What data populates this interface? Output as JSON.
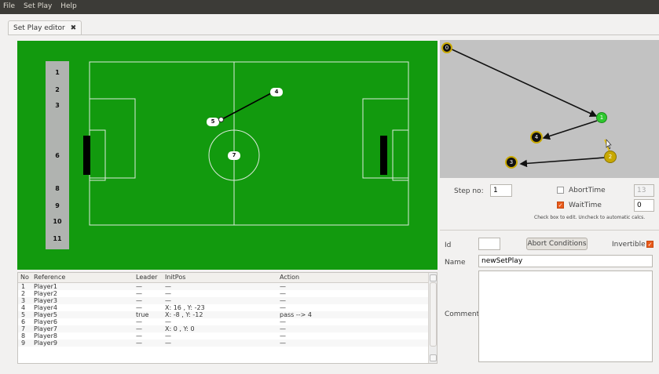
{
  "menubar": {
    "file": "File",
    "set_play": "Set Play",
    "help": "Help"
  },
  "tab": {
    "label": "Set Play editor",
    "close": "✖"
  },
  "roster": [
    "1",
    "2",
    "3",
    "6",
    "8",
    "9",
    "10",
    "11"
  ],
  "field_players": [
    {
      "label": "4"
    },
    {
      "label": "5"
    },
    {
      "label": "7"
    }
  ],
  "path_nodes": [
    {
      "label": "0",
      "color": "#c8a800"
    },
    {
      "label": "1",
      "color": "#2ec82e"
    },
    {
      "label": "2",
      "color": "#c8a800"
    },
    {
      "label": "3",
      "color": "#c8a800"
    },
    {
      "label": "4",
      "color": "#c8a800"
    }
  ],
  "step": {
    "label": "Step no:",
    "value": "1",
    "abort_label": "AbortTime",
    "abort_value": "13",
    "abort_checked": false,
    "wait_label": "WaitTime",
    "wait_value": "0",
    "wait_checked": true,
    "hint": "Check box to edit. Uncheck to automatic calcs."
  },
  "props": {
    "id_label": "Id",
    "id_value": "",
    "abort_button": "Abort Conditions",
    "invertible_label": "Invertible",
    "invertible_checked": true,
    "name_label": "Name",
    "name_value": "newSetPlay",
    "comment_label": "Comment",
    "comment_value": ""
  },
  "table": {
    "headers": [
      "No",
      "Reference",
      "Leader",
      "InitPos",
      "Action"
    ],
    "rows": [
      [
        "1",
        "Player1",
        "—",
        "—",
        "—"
      ],
      [
        "2",
        "Player2",
        "—",
        "—",
        "—"
      ],
      [
        "3",
        "Player3",
        "—",
        "—",
        "—"
      ],
      [
        "4",
        "Player4",
        "—",
        "X: 16 , Y: -23",
        "—"
      ],
      [
        "5",
        "Player5",
        "true",
        "X: -8 , Y: -12",
        "pass --> 4"
      ],
      [
        "6",
        "Player6",
        "—",
        "—",
        "—"
      ],
      [
        "7",
        "Player7",
        "—",
        "X: 0 , Y: 0",
        "—"
      ],
      [
        "8",
        "Player8",
        "—",
        "—",
        "—"
      ],
      [
        "9",
        "Player9",
        "—",
        "—",
        "—"
      ]
    ]
  },
  "colors": {
    "pitch": "#129a0e",
    "accent": "#e95a1a"
  }
}
